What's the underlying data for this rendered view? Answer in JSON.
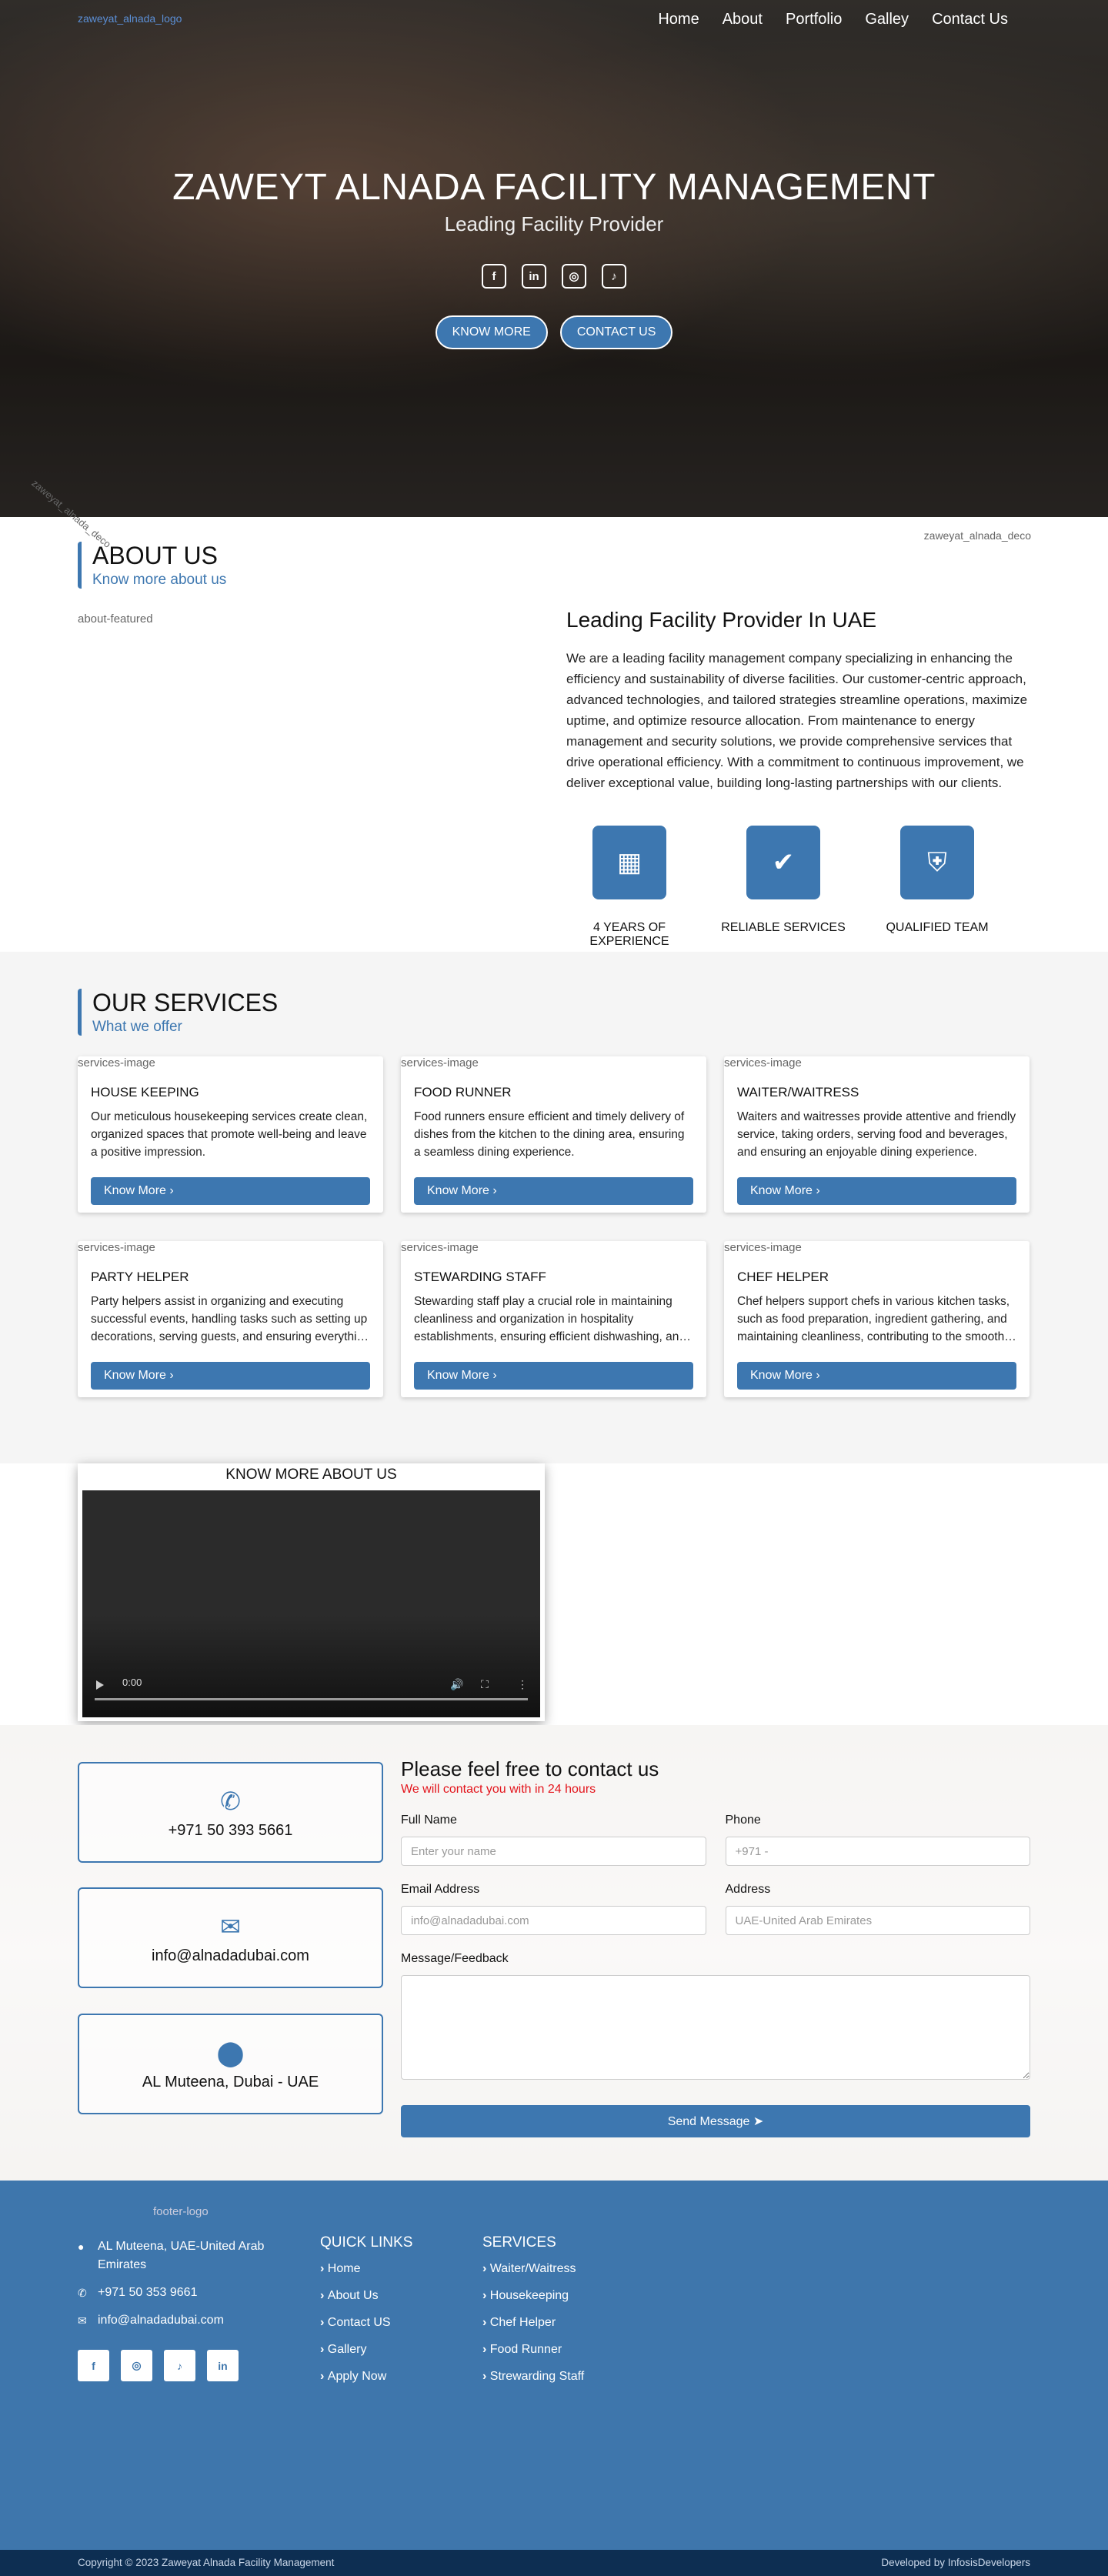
{
  "nav": {
    "logo_alt": "zaweyat_alnada_logo",
    "items": [
      "Home",
      "About",
      "Portfolio",
      "Galley",
      "Contact Us"
    ]
  },
  "hero": {
    "title": "ZAWEYT ALNADA FACILITY MANAGEMENT",
    "subtitle": "Leading Facility Provider",
    "social_icons": [
      "facebook-icon",
      "linkedin-icon",
      "instagram-icon",
      "tiktok-icon"
    ],
    "btn_know": "KNOW MORE",
    "btn_contact": "CONTACT US"
  },
  "about": {
    "deco_left": "zaweyat_alnada_deco",
    "deco_right": "zaweyat_alnada_deco",
    "heading": "ABOUT US",
    "subheading": "Know more about us",
    "image_alt": "about-featured",
    "title": "Leading Facility Provider In UAE",
    "body": "We are a leading facility management company specializing in enhancing the efficiency and sustainability of diverse facilities. Our customer-centric approach, advanced technologies, and tailored strategies streamline operations, maximize uptime, and optimize resource allocation. From maintenance to energy management and security solutions, we provide comprehensive services that drive operational efficiency. With a commitment to continuous improvement, we deliver exceptional value, building long-lasting partnerships with our clients.",
    "features": [
      {
        "icon": "calendar-icon",
        "label": "4 YEARS OF EXPERIENCE"
      },
      {
        "icon": "check-circle-icon",
        "label": "RELIABLE SERVICES"
      },
      {
        "icon": "shield-icon",
        "label": "QUALIFIED TEAM"
      }
    ]
  },
  "services": {
    "heading": "OUR SERVICES",
    "subheading": "What we offer",
    "image_alt": "services-image",
    "button_label": "Know More",
    "items": [
      {
        "title": "HOUSE KEEPING",
        "text": "Our meticulous housekeeping services create clean, organized spaces that promote well-being and leave a positive impression."
      },
      {
        "title": "FOOD RUNNER",
        "text": "Food runners ensure efficient and timely delivery of dishes from the kitchen to the dining area, ensuring a seamless dining experience."
      },
      {
        "title": "WAITER/WAITRESS",
        "text": "Waiters and waitresses provide attentive and friendly service, taking orders, serving food and beverages, and ensuring an enjoyable dining experience."
      },
      {
        "title": "PARTY HELPER",
        "text": "Party helpers assist in organizing and executing successful events, handling tasks such as setting up decorations, serving guests, and ensuring everything runs smoothly."
      },
      {
        "title": "STEWARDING STAFF",
        "text": "Stewarding staff play a crucial role in maintaining cleanliness and organization in hospitality establishments, ensuring efficient dishwashing, and more."
      },
      {
        "title": "CHEF HELPER",
        "text": "Chef helpers support chefs in various kitchen tasks, such as food preparation, ingredient gathering, and maintaining cleanliness, contributing to the smooth operation of the kitchen."
      }
    ]
  },
  "video": {
    "title": "KNOW MORE ABOUT US",
    "time": "0:00"
  },
  "contact": {
    "phone": "+971 50 393 5661",
    "email": "info@alnadadubai.com",
    "address": "AL Muteena, Dubai - UAE",
    "form_title": "Please feel free to contact us",
    "form_sub": "We will contact you with in 24 hours",
    "full_name_label": "Full Name",
    "full_name_placeholder": "Enter your name",
    "phone_label": "Phone",
    "phone_placeholder": "+971 -",
    "email_label": "Email Address",
    "email_placeholder": "info@alnadadubai.com",
    "address_label": "Address",
    "address_placeholder": "UAE-United Arab Emirates",
    "message_label": "Message/Feedback",
    "send_label": "Send Message"
  },
  "footer": {
    "logo_alt": "footer-logo",
    "address": "AL Muteena, UAE-United Arab Emirates",
    "phone": "+971 50 353 9661",
    "email": "info@alnadadubai.com",
    "social_icons": [
      "facebook-icon",
      "instagram-icon",
      "tiktok-icon",
      "linkedin-icon"
    ],
    "quick_links_title": "QUICK LINKS",
    "quick_links": [
      "Home",
      "About Us",
      "Contact US",
      "Gallery",
      "Apply Now"
    ],
    "services_title": "SERVICES",
    "services_links": [
      "Waiter/Waitress",
      "Housekeeping",
      "Chef Helper",
      "Food Runner",
      "Strewarding Staff"
    ],
    "copyright": "Copyright © 2023 Zaweyat Alnada Facility Management",
    "developer": "Developed by InfosisDevelopers"
  },
  "colors": {
    "primary": "#3d77b0",
    "footer_bg": "#3e76ac",
    "footer_bottom": "#0d2e52",
    "accent_red": "#e3141b"
  }
}
